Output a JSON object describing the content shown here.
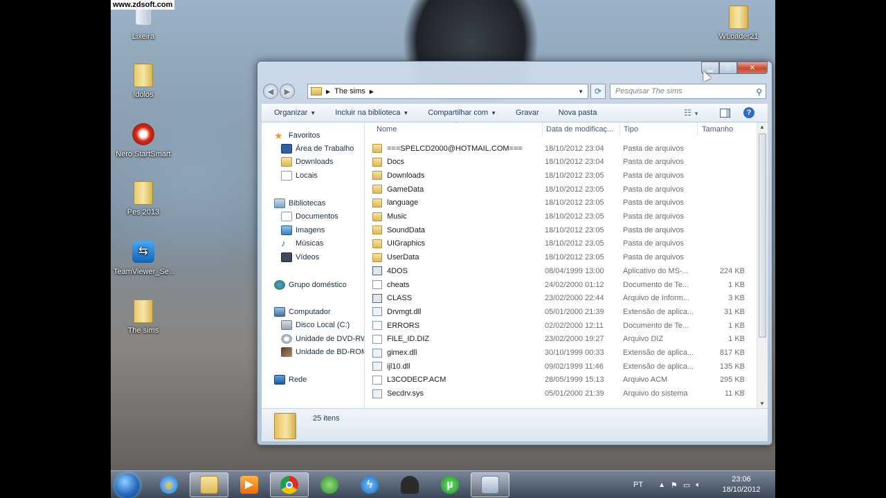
{
  "watermark": "www.zdsoft.com",
  "desktop": {
    "icons_left": [
      {
        "label": "Lixeira",
        "icon": "recycle-bin-icon"
      },
      {
        "label": "Idolos",
        "icon": "folder-icon"
      },
      {
        "label": "Nero StartSmart",
        "icon": "nero-icon"
      },
      {
        "label": "Pes 2013",
        "icon": "folder-icon"
      },
      {
        "label": "TeamViewer_Se...",
        "icon": "teamviewer-icon"
      },
      {
        "label": "The sims",
        "icon": "folder-icon"
      }
    ],
    "icon_right": {
      "label": "WLoader21",
      "icon": "folder-icon"
    }
  },
  "window": {
    "breadcrumb": [
      "The sims"
    ],
    "search_placeholder": "Pesquisar The sims",
    "toolbar": [
      "Organizar",
      "Incluir na biblioteca",
      "Compartilhar com",
      "Gravar",
      "Nova pasta"
    ],
    "nav": {
      "favorites": {
        "label": "Favoritos",
        "items": [
          "Área de Trabalho",
          "Downloads",
          "Locais"
        ]
      },
      "libraries": {
        "label": "Bibliotecas",
        "items": [
          "Documentos",
          "Imagens",
          "Músicas",
          "Vídeos"
        ]
      },
      "homegroup": "Grupo doméstico",
      "computer": {
        "label": "Computador",
        "items": [
          "Disco Local (C:)",
          "Unidade de DVD-RW",
          "Unidade de BD-ROM"
        ]
      },
      "network": "Rede"
    },
    "columns": {
      "name": "Nome",
      "date": "Data de modificaç...",
      "type": "Tipo",
      "size": "Tamanho"
    },
    "files": [
      {
        "name": "===SPELCD2000@HOTMAIL.COM===",
        "date": "18/10/2012 23:04",
        "type": "Pasta de arquivos",
        "size": "",
        "kind": "folder"
      },
      {
        "name": "Docs",
        "date": "18/10/2012 23:04",
        "type": "Pasta de arquivos",
        "size": "",
        "kind": "folder"
      },
      {
        "name": "Downloads",
        "date": "18/10/2012 23:05",
        "type": "Pasta de arquivos",
        "size": "",
        "kind": "folder"
      },
      {
        "name": "GameData",
        "date": "18/10/2012 23:05",
        "type": "Pasta de arquivos",
        "size": "",
        "kind": "folder"
      },
      {
        "name": "language",
        "date": "18/10/2012 23:05",
        "type": "Pasta de arquivos",
        "size": "",
        "kind": "folder"
      },
      {
        "name": "Music",
        "date": "18/10/2012 23:05",
        "type": "Pasta de arquivos",
        "size": "",
        "kind": "folder"
      },
      {
        "name": "SoundData",
        "date": "18/10/2012 23:05",
        "type": "Pasta de arquivos",
        "size": "",
        "kind": "folder"
      },
      {
        "name": "UIGraphics",
        "date": "18/10/2012 23:05",
        "type": "Pasta de arquivos",
        "size": "",
        "kind": "folder"
      },
      {
        "name": "UserData",
        "date": "18/10/2012 23:05",
        "type": "Pasta de arquivos",
        "size": "",
        "kind": "folder"
      },
      {
        "name": "4DOS",
        "date": "08/04/1999 13:00",
        "type": "Aplicativo do MS-...",
        "size": "224 KB",
        "kind": "exe"
      },
      {
        "name": "cheats",
        "date": "24/02/2000 01:12",
        "type": "Documento de Te...",
        "size": "1 KB",
        "kind": "doc"
      },
      {
        "name": "CLASS",
        "date": "23/02/2000 22:44",
        "type": "Arquivo de Inform...",
        "size": "3 KB",
        "kind": "exe"
      },
      {
        "name": "Drvmgt.dll",
        "date": "05/01/2000 21:39",
        "type": "Extensão de aplica...",
        "size": "31 KB",
        "kind": "dll"
      },
      {
        "name": "ERRORS",
        "date": "02/02/2000 12:11",
        "type": "Documento de Te...",
        "size": "1 KB",
        "kind": "doc"
      },
      {
        "name": "FILE_ID.DIZ",
        "date": "23/02/2000 19:27",
        "type": "Arquivo DIZ",
        "size": "1 KB",
        "kind": "doc"
      },
      {
        "name": "gimex.dll",
        "date": "30/10/1999 00:33",
        "type": "Extensão de aplica...",
        "size": "817 KB",
        "kind": "dll"
      },
      {
        "name": "ijl10.dll",
        "date": "09/02/1999 11:46",
        "type": "Extensão de aplica...",
        "size": "135 KB",
        "kind": "dll"
      },
      {
        "name": "L3CODECP.ACM",
        "date": "28/05/1999 15:13",
        "type": "Arquivo ACM",
        "size": "295 KB",
        "kind": "doc"
      },
      {
        "name": "Secdrv.sys",
        "date": "05/01/2000 21:39",
        "type": "Arquivo do sistema",
        "size": "11 KB",
        "kind": "dll"
      }
    ],
    "status": "25 itens"
  },
  "taskbar": {
    "apps": [
      "internet-explorer-icon",
      "file-explorer-icon",
      "media-player-icon",
      "chrome-icon",
      "messenger-icon",
      "jdownloader-icon",
      "movie-maker-icon",
      "utorrent-icon",
      "recorder-icon"
    ],
    "language": "PT",
    "time": "23:06",
    "date": "18/10/2012"
  }
}
